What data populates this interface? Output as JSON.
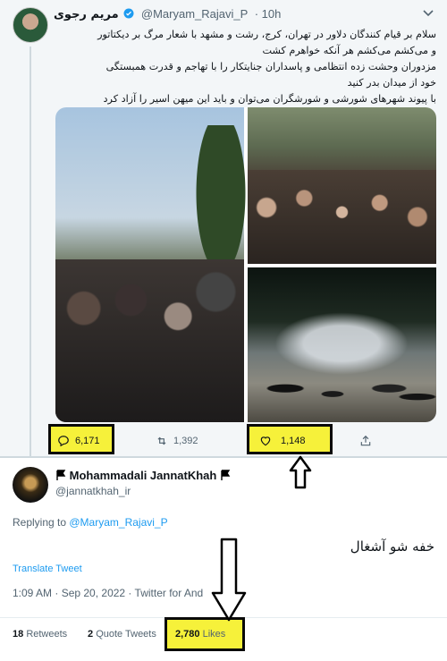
{
  "tweet1": {
    "author_name": "مریم رجوی",
    "author_handle": "@Maryam_Rajavi_P",
    "time": "· 10h",
    "text_lines": [
      "سلام بر قیام کنندگان دلاور در تهران، کرج، رشت و مشهد با شعار مرگ بر دیکتاتور",
      "و می‌کشم می‌کشم هر آنکه خواهرم کشت",
      "مزدوران وحشت زده انتظامی و پاسداران جنایتکار را با تهاجم و قدرت همبستگی",
      "خود از میدان بدر کنید",
      "با پیوند شهرهای شورشی و شورشگران می‌توان و باید این میهن اسیر را آزاد کرد"
    ],
    "actions": {
      "replies": "6,171",
      "retweets": "1,392",
      "likes": "1,148"
    },
    "highlight_color": "#f6f13a"
  },
  "tweet2": {
    "author_name": "Mohammadali JannatKhah",
    "author_handle": "@jannatkhah_ir",
    "replying_prefix": "Replying to ",
    "replying_to": "@Maryam_Rajavi_P",
    "text": "خفه شو آشغال",
    "translate_label": "Translate Tweet",
    "meta": "1:09 AM · Sep 20, 2022 · Twitter for And",
    "stats": {
      "retweets_value": "18",
      "retweets_label": "Retweets",
      "quotes_value": "2",
      "quotes_label": "Quote Tweets",
      "likes_value": "2,780",
      "likes_label": "Likes"
    }
  }
}
